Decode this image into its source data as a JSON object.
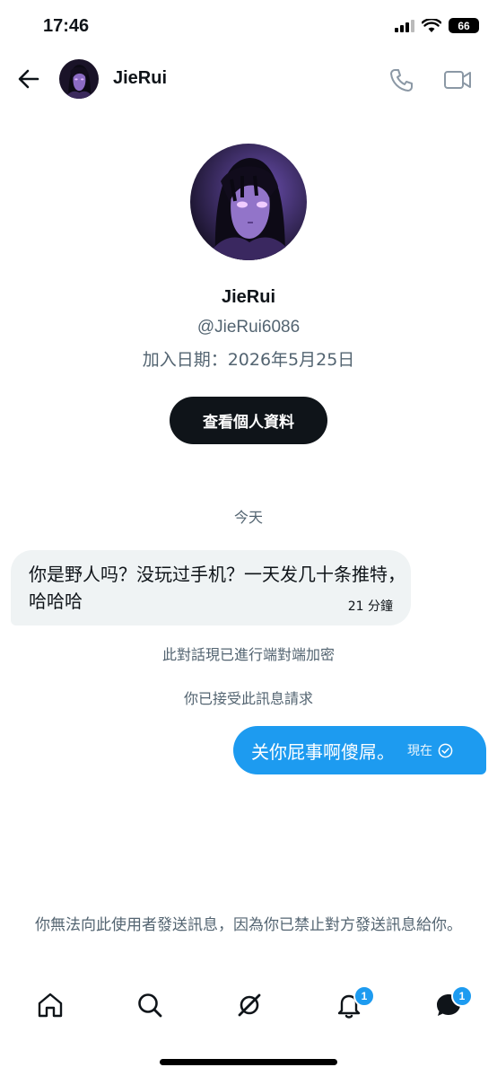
{
  "status_bar": {
    "time": "17:46",
    "battery": "66"
  },
  "header": {
    "name": "JieRui"
  },
  "profile": {
    "name": "JieRui",
    "handle": "@JieRui6086",
    "joined": "加入日期：2026年5月25日",
    "view_profile_label": "查看個人資料"
  },
  "conversation": {
    "day_label": "今天",
    "incoming": {
      "text": "你是野人吗？没玩过手机？一天发几十条推特，哈哈哈",
      "time": "21 分鐘"
    },
    "encryption_notice": "此對話現已進行端對端加密",
    "accepted_notice": "你已接受此訊息請求",
    "outgoing": {
      "text": "关你屁事啊傻屌。",
      "time": "現在"
    }
  },
  "blocked_notice": "你無法向此使用者發送訊息，因為你已禁止對方發送訊息給你。",
  "bottom_nav": {
    "icons": [
      "home-icon",
      "search-icon",
      "grok-icon",
      "bell-icon",
      "messages-icon"
    ],
    "notifications_badge": "1",
    "messages_badge": "1"
  },
  "colors": {
    "accent": "#1d9bf0",
    "bubble_incoming": "#eff3f4",
    "button_dark": "#0f1419",
    "muted_text": "#536471"
  }
}
